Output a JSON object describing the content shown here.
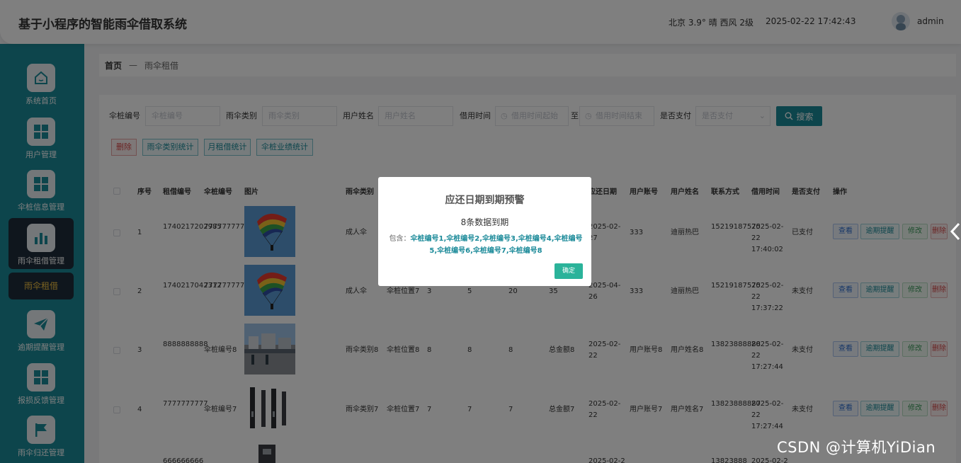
{
  "header": {
    "title": "基于小程序的智能雨伞借取系统",
    "weather": "北京  3.9°  晴  西风  2级",
    "datetime": "2025-02-22 17:42:43",
    "username": "admin"
  },
  "sidebar": {
    "items": [
      {
        "label": "系统首页",
        "icon": "home-icon"
      },
      {
        "label": "用户管理",
        "icon": "grid-icon"
      },
      {
        "label": "伞桩信息管理",
        "icon": "grid-icon"
      },
      {
        "label": "雨伞租借管理",
        "icon": "bar-chart-icon"
      },
      {
        "label": "逾期提醒管理",
        "icon": "paper-plane-icon"
      },
      {
        "label": "报损反馈管理",
        "icon": "grid-icon"
      },
      {
        "label": "雨伞归还管理",
        "icon": "flag-icon"
      }
    ],
    "submenu_label": "雨伞租借"
  },
  "breadcrumb": {
    "home": "首页",
    "sep": "—",
    "current": "雨伞租借"
  },
  "filters": {
    "pile_label": "伞桩编号",
    "pile_placeholder": "伞桩编号",
    "type_label": "雨伞类别",
    "type_placeholder": "雨伞类别",
    "user_label": "用户姓名",
    "user_placeholder": "用户姓名",
    "time_label": "借用时间",
    "time_start_placeholder": "借用时间起始",
    "time_to": "至",
    "time_end_placeholder": "借用时间结束",
    "paid_label": "是否支付",
    "paid_placeholder": "是否支付",
    "search_label": "搜索"
  },
  "toolbar": {
    "delete": "删除",
    "type_stats": "雨伞类别统计",
    "month_stats": "月租借统计",
    "pile_stats": "伞桩业绩统计"
  },
  "table": {
    "headers": [
      "序号",
      "租借编号",
      "伞桩编号",
      "图片",
      "雨伞类别",
      "应还日期",
      "用户账号",
      "用户姓名",
      "联系方式",
      "借用时间",
      "是否支付",
      "操作"
    ],
    "actions": {
      "view": "查看",
      "remind": "逾期提醒",
      "edit": "修改",
      "delete": "删除"
    },
    "rows": [
      {
        "no": "1",
        "rent_no": "1740217202985",
        "pile_no": "7777777777",
        "umbrella_type": "成人伞",
        "location": "",
        "c1": "",
        "c2": "",
        "c3": "",
        "amount": "",
        "due": "2025-02-27",
        "account": "333",
        "name": "迪丽热巴",
        "phone": "15219187575",
        "time": "2025-02-22 17:40:02",
        "paid": "已支付"
      },
      {
        "no": "2",
        "rent_no": "1740217042312",
        "pile_no": "7777777777",
        "umbrella_type": "成人伞",
        "location": "伞桩位置7",
        "c1": "3",
        "c2": "5",
        "c3": "20",
        "amount": "35",
        "due": "2025-04-26",
        "account": "333",
        "name": "迪丽热巴",
        "phone": "15219187575",
        "time": "2025-02-22 17:37:22",
        "paid": "未支付"
      },
      {
        "no": "3",
        "rent_no": "8888888888",
        "pile_no": "伞桩编号8",
        "umbrella_type": "雨伞类别8",
        "location": "伞桩位置8",
        "c1": "8",
        "c2": "8",
        "c3": "8",
        "amount": "总金额8",
        "due": "2025-02-22",
        "account": "用户账号8",
        "name": "用户姓名8",
        "phone": "13823888888",
        "time": "2025-02-22 17:27:44",
        "paid": "未支付"
      },
      {
        "no": "4",
        "rent_no": "7777777777",
        "pile_no": "伞桩编号7",
        "umbrella_type": "雨伞类别7",
        "location": "伞桩位置7",
        "c1": "7",
        "c2": "7",
        "c3": "7",
        "amount": "总金额7",
        "due": "2025-02-22",
        "account": "用户账号7",
        "name": "用户姓名7",
        "phone": "13823888887",
        "time": "2025-02-22 17:27:44",
        "paid": "未支付"
      },
      {
        "no": "",
        "rent_no": "666666666",
        "pile_no": "",
        "umbrella_type": "",
        "location": "",
        "c1": "",
        "c2": "",
        "c3": "",
        "amount": "",
        "due": "2025-02-2",
        "account": "",
        "name": "",
        "phone": "13823888",
        "time": "2025-02-2",
        "paid": ""
      }
    ]
  },
  "modal": {
    "title": "应还日期到期预警",
    "subtitle": "8条数据到期",
    "prefix": "包含：",
    "items": "伞桩编号1,伞桩编号2,伞桩编号3,伞桩编号4,伞桩编号5,伞桩编号6,伞桩编号7,伞桩编号8",
    "ok": "确定"
  },
  "watermark": "CSDN @计算机YiDian",
  "colors": {
    "primary": "#1b8a99",
    "sidebar": "#1b8a99",
    "active": "#1f2d3a",
    "highlight": "#f5c342",
    "confirm": "#2bb39a"
  }
}
